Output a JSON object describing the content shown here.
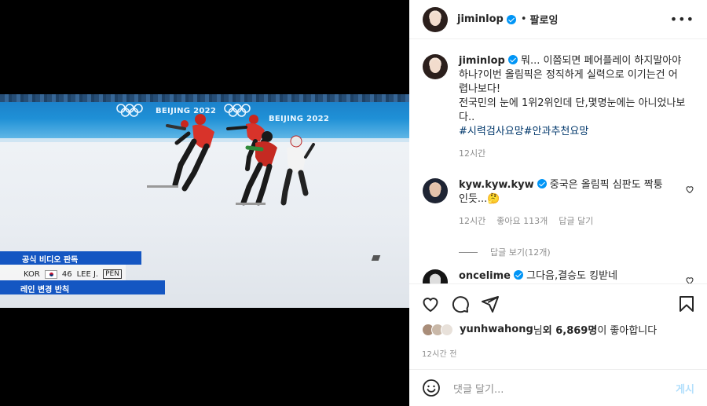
{
  "post": {
    "username": "jiminlop",
    "dot": "•",
    "follow_label": "팔로잉",
    "more_label": "•••"
  },
  "video": {
    "board_text": "BEIJING 2022",
    "lower_third": {
      "title": "공식 비디오 판독",
      "country": "KOR",
      "bib": "46",
      "athlete": "LEE J.",
      "penalty": "PEN",
      "reason": "레인 변경 반칙"
    }
  },
  "caption": {
    "username": "jiminlop",
    "text": "뭐... 이쯤되면 페어플레이 하지말아야하나?이번 올림픽은 정직하게 실력으로 이기는건 어렵나보다!",
    "text2": "전국민의 눈에 1위2위인데 단,몇명눈에는 아니었나보다..",
    "hashtags": "#시력검사요망#안과추천요망",
    "time": "12시간"
  },
  "comments": [
    {
      "username": "kyw.kyw.kyw",
      "text": "중국은 올림픽 심판도 짝퉁인듯...",
      "emoji": "🤔",
      "time": "12시간",
      "likes": "좋아요 113개",
      "reply": "답글 달기",
      "view_replies": "답글 보기(12개)"
    },
    {
      "username": "oncelime",
      "text": "그다음,결승도 킹받네"
    }
  ],
  "likes": {
    "user": "yunhwahong",
    "suffix": "님 ",
    "others": "외 6,869명",
    "tail": "이 좋아합니다"
  },
  "timestamp": "12시간 전",
  "add_comment": {
    "placeholder": "댓글 달기...",
    "post_label": "게시"
  },
  "icons": [
    "heart-icon",
    "comment-icon",
    "share-icon",
    "bookmark-icon",
    "emoji-icon",
    "verified-icon",
    "more-icon"
  ],
  "colors": {
    "verified": "#0095f6",
    "link": "#00376b",
    "post_disabled": "#b2dffc",
    "muted": "#8e8e8e",
    "broadcast_blue": "#1456c2"
  }
}
